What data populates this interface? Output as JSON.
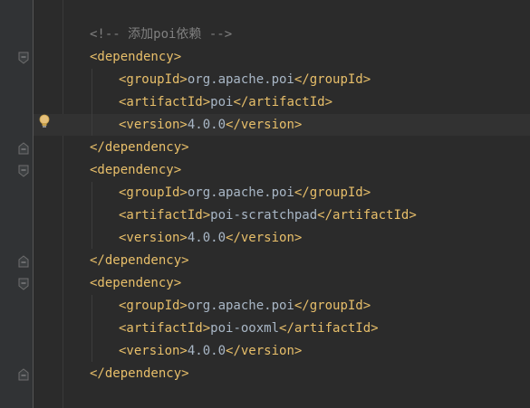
{
  "editor": {
    "lines": [
      {
        "parts": [
          {
            "cls": "comment",
            "text": "<!-- 添加poi依赖 -->"
          }
        ]
      },
      {
        "parts": [
          {
            "cls": "tag",
            "text": "<dependency>"
          }
        ]
      },
      {
        "parts": [
          {
            "cls": "tag",
            "text": "<groupId>"
          },
          {
            "cls": "txt",
            "text": "org.apache.poi"
          },
          {
            "cls": "tag",
            "text": "</groupId>"
          }
        ]
      },
      {
        "parts": [
          {
            "cls": "tag",
            "text": "<artifactId>"
          },
          {
            "cls": "txt",
            "text": "poi"
          },
          {
            "cls": "tag",
            "text": "</artifactId>"
          }
        ]
      },
      {
        "parts": [
          {
            "cls": "tag",
            "text": "<version>"
          },
          {
            "cls": "txt",
            "text": "4.0.0"
          },
          {
            "cls": "tag",
            "text": "</version>"
          }
        ]
      },
      {
        "parts": [
          {
            "cls": "tag",
            "text": "</dependency>"
          }
        ]
      },
      {
        "parts": [
          {
            "cls": "tag",
            "text": "<dependency>"
          }
        ]
      },
      {
        "parts": [
          {
            "cls": "tag",
            "text": "<groupId>"
          },
          {
            "cls": "txt",
            "text": "org.apache.poi"
          },
          {
            "cls": "tag",
            "text": "</groupId>"
          }
        ]
      },
      {
        "parts": [
          {
            "cls": "tag",
            "text": "<artifactId>"
          },
          {
            "cls": "txt",
            "text": "poi-scratchpad"
          },
          {
            "cls": "tag",
            "text": "</artifactId>"
          }
        ]
      },
      {
        "parts": [
          {
            "cls": "tag",
            "text": "<version>"
          },
          {
            "cls": "txt",
            "text": "4.0.0"
          },
          {
            "cls": "tag",
            "text": "</version>"
          }
        ]
      },
      {
        "parts": [
          {
            "cls": "tag",
            "text": "</dependency>"
          }
        ]
      },
      {
        "parts": [
          {
            "cls": "tag",
            "text": "<dependency>"
          }
        ]
      },
      {
        "parts": [
          {
            "cls": "tag",
            "text": "<groupId>"
          },
          {
            "cls": "txt",
            "text": "org.apache.poi"
          },
          {
            "cls": "tag",
            "text": "</groupId>"
          }
        ]
      },
      {
        "parts": [
          {
            "cls": "tag",
            "text": "<artifactId>"
          },
          {
            "cls": "txt",
            "text": "poi-ooxml"
          },
          {
            "cls": "tag",
            "text": "</artifactId>"
          }
        ]
      },
      {
        "parts": [
          {
            "cls": "tag",
            "text": "<version>"
          },
          {
            "cls": "txt",
            "text": "4.0.0"
          },
          {
            "cls": "tag",
            "text": "</version>"
          }
        ]
      },
      {
        "parts": [
          {
            "cls": "tag",
            "text": "</dependency>"
          }
        ]
      }
    ]
  },
  "icons": {
    "fold_marker": "fold-marker-icon",
    "intention": "lightbulb-icon"
  },
  "colors": {
    "background": "#2b2b2b",
    "gutter": "#313335",
    "comment": "#808080",
    "tag": "#e8bf6a",
    "text": "#a9b7c6",
    "current_line": "#323232"
  }
}
